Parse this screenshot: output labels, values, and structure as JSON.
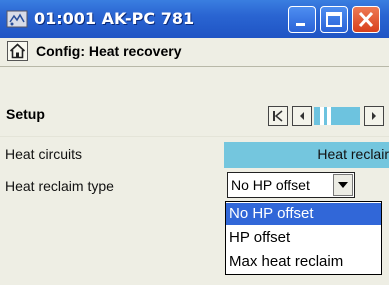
{
  "window": {
    "title": "01:001 AK-PC 781",
    "icon": "controller-icon",
    "minimize_icon": "minimize-icon",
    "maximize_icon": "maximize-icon",
    "close_icon": "close-icon"
  },
  "header": {
    "home_icon": "home-icon",
    "title": "Config: Heat recovery"
  },
  "setup": {
    "label": "Setup",
    "nav": [
      "first-page-icon",
      "previous-page-icon",
      "page-indicator",
      "next-page-icon"
    ]
  },
  "rows": [
    {
      "label": "Heat circuits",
      "value": "Heat reclair"
    },
    {
      "label": "Heat reclaim type",
      "value": "No HP offset"
    }
  ],
  "dropdown": {
    "options": [
      "No HP offset",
      "HP offset",
      "Max heat reclaim"
    ],
    "selected": "No HP offset"
  },
  "colors": {
    "titlebar": "#2a65d2",
    "highlight": "#74c6de",
    "selected_option": "#3167d8",
    "background": "#eeeee4"
  }
}
